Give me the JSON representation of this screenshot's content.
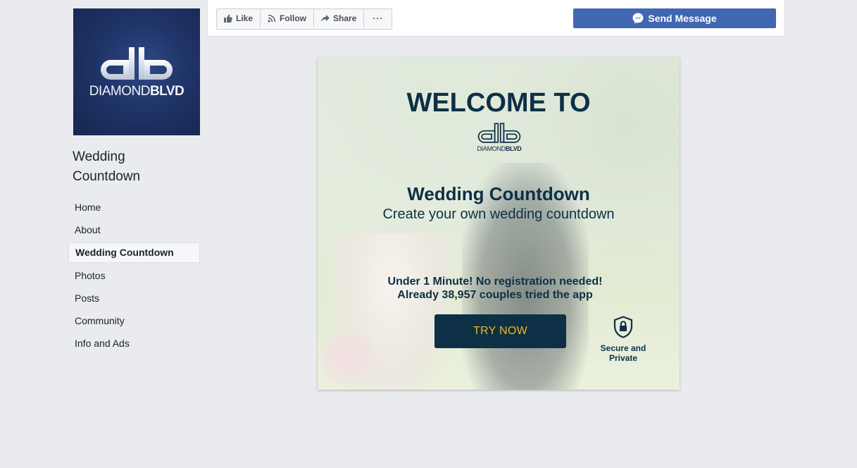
{
  "sidebar": {
    "logo": {
      "text_regular": "DIAMOND",
      "text_bold": "BLVD"
    },
    "page_name": "Wedding Countdown",
    "nav": [
      {
        "label": "Home"
      },
      {
        "label": "About"
      },
      {
        "label": "Wedding Countdown",
        "active": true
      },
      {
        "label": "Photos"
      },
      {
        "label": "Posts"
      },
      {
        "label": "Community"
      },
      {
        "label": "Info and Ads"
      }
    ]
  },
  "topbar": {
    "like_label": "Like",
    "follow_label": "Follow",
    "share_label": "Share",
    "more_label": "···",
    "send_message_label": "Send Message"
  },
  "card": {
    "welcome": "WELCOME TO",
    "logo_text_regular": "DIAMOND",
    "logo_text_bold": "BLVD",
    "title": "Wedding Countdown",
    "subtitle": "Create your own wedding countdown",
    "line1": "Under 1 Minute! No registration needed!",
    "line2": "Already 38,957 couples tried the app",
    "cta": "TRY NOW",
    "secure_label": "Secure and Private"
  },
  "colors": {
    "brand_navy": "#0d3046",
    "cta_text": "#f0b81b",
    "messenger_blue": "#4267b2",
    "page_bg": "#e9ebee"
  },
  "icons": [
    "like-icon",
    "follow-icon",
    "share-icon",
    "messenger-icon",
    "lock-shield-icon"
  ]
}
